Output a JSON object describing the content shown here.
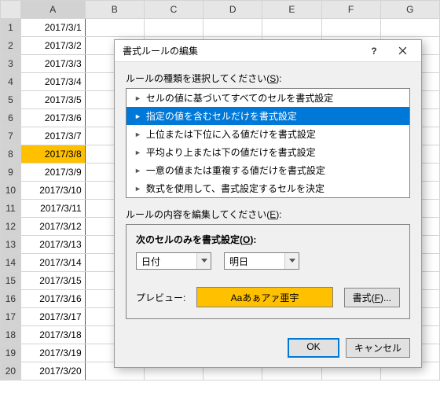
{
  "sheet": {
    "columns": [
      "A",
      "B",
      "C",
      "D",
      "E",
      "F",
      "G"
    ],
    "rows": [
      {
        "n": 1,
        "A": "2017/3/1"
      },
      {
        "n": 2,
        "A": "2017/3/2"
      },
      {
        "n": 3,
        "A": "2017/3/3"
      },
      {
        "n": 4,
        "A": "2017/3/4"
      },
      {
        "n": 5,
        "A": "2017/3/5"
      },
      {
        "n": 6,
        "A": "2017/3/6"
      },
      {
        "n": 7,
        "A": "2017/3/7"
      },
      {
        "n": 8,
        "A": "2017/3/8",
        "hl": true
      },
      {
        "n": 9,
        "A": "2017/3/9"
      },
      {
        "n": 10,
        "A": "2017/3/10"
      },
      {
        "n": 11,
        "A": "2017/3/11"
      },
      {
        "n": 12,
        "A": "2017/3/12"
      },
      {
        "n": 13,
        "A": "2017/3/13"
      },
      {
        "n": 14,
        "A": "2017/3/14"
      },
      {
        "n": 15,
        "A": "2017/3/15"
      },
      {
        "n": 16,
        "A": "2017/3/16"
      },
      {
        "n": 17,
        "A": "2017/3/17"
      },
      {
        "n": 18,
        "A": "2017/3/18"
      },
      {
        "n": 19,
        "A": "2017/3/19"
      },
      {
        "n": 20,
        "A": "2017/3/20"
      }
    ]
  },
  "dialog": {
    "title": "書式ルールの編集",
    "help_icon": "?",
    "section1_label_pre": "ルールの種類を選択してください(",
    "section1_label_u": "S",
    "section1_label_post": "):",
    "rules": [
      "セルの値に基づいてすべてのセルを書式設定",
      "指定の値を含むセルだけを書式設定",
      "上位または下位に入る値だけを書式設定",
      "平均より上または下の値だけを書式設定",
      "一意の値または重複する値だけを書式設定",
      "数式を使用して、書式設定するセルを決定"
    ],
    "selected_rule_index": 1,
    "section2_label_pre": "ルールの内容を編集してください(",
    "section2_label_u": "E",
    "section2_label_post": "):",
    "sublabel_pre": "次のセルのみを書式設定(",
    "sublabel_u": "O",
    "sublabel_post": "):",
    "select1": "日付",
    "select2": "明日",
    "preview_label": "プレビュー:",
    "preview_sample": "Aaあぁアァ亜宇",
    "format_btn_pre": "書式(",
    "format_btn_u": "F",
    "format_btn_post": ")...",
    "ok": "OK",
    "cancel": "キャンセル"
  }
}
